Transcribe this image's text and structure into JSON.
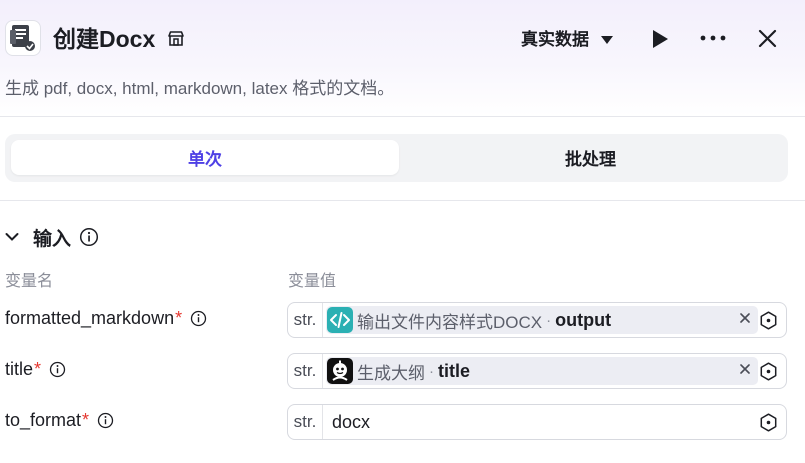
{
  "header": {
    "title": "创建Docx",
    "data_mode": "真实数据",
    "description": "生成 pdf, docx, html, markdown, latex 格式的文档。"
  },
  "tabs": [
    {
      "label": "单次",
      "active": true
    },
    {
      "label": "批处理",
      "active": false
    }
  ],
  "inputs_section": {
    "title": "输入",
    "col_name": "变量名",
    "col_value": "变量值",
    "rows": [
      {
        "name": "formatted_markdown",
        "required": "*",
        "type": "str.",
        "ref_node": "输出文件内容样式DOCX",
        "ref_sep": "·",
        "ref_var": "output",
        "icon": "code-icon"
      },
      {
        "name": "title",
        "required": "*",
        "type": "str.",
        "ref_node": "生成大纲",
        "ref_sep": "·",
        "ref_var": "title",
        "icon": "robot-icon"
      },
      {
        "name": "to_format",
        "required": "*",
        "type": "str.",
        "value": "docx"
      }
    ]
  },
  "colors": {
    "accent": "#4e40e5",
    "required": "#e5372f",
    "code_node": "#2bb0b3",
    "robot_node": "#111111"
  }
}
